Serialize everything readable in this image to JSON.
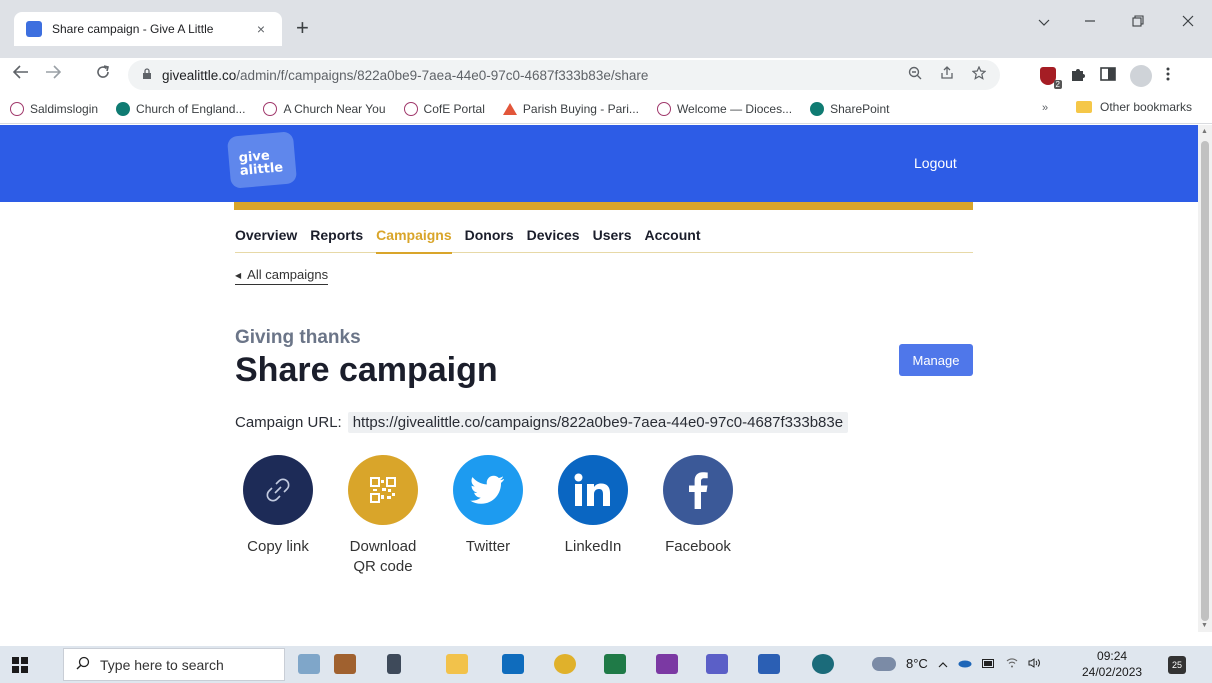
{
  "browser": {
    "tab_title": "Share campaign - Give A Little",
    "tab_close": "×",
    "new_tab": "+",
    "url_host": "givealittle.co",
    "url_path": "/admin/f/campaigns/822a0be9-7aea-44e0-97c0-4687f333b83e/share",
    "extension_badge": "2",
    "bookmarks": [
      {
        "label": "Saldimslogin",
        "icon": "globe-cross-icon"
      },
      {
        "label": "Church of England...",
        "icon": "sharepoint-icon"
      },
      {
        "label": "A Church Near You",
        "icon": "globe-cross-icon"
      },
      {
        "label": "CofE Portal",
        "icon": "globe-cross-icon"
      },
      {
        "label": "Parish Buying - Pari...",
        "icon": "church-icon"
      },
      {
        "label": "Welcome — Dioces...",
        "icon": "globe-cross-icon"
      },
      {
        "label": "SharePoint",
        "icon": "sharepoint-icon"
      }
    ],
    "bookmarks_more": "»",
    "other_bookmarks": "Other bookmarks"
  },
  "site": {
    "logo_text": "give alittle",
    "logout_label": "Logout",
    "nav": [
      "Overview",
      "Reports",
      "Campaigns",
      "Donors",
      "Devices",
      "Users",
      "Account"
    ],
    "active_nav": "Campaigns",
    "back_link": "All campaigns",
    "eyebrow": "Giving thanks",
    "headline": "Share campaign",
    "manage_label": "Manage",
    "url_label": "Campaign URL:",
    "campaign_url": "https://givealittle.co/campaigns/822a0be9-7aea-44e0-97c0-4687f333b83e",
    "share": [
      {
        "label": "Copy link",
        "icon": "link-icon",
        "color": "#1d2b57"
      },
      {
        "label": "Download QR code",
        "icon": "qr-code-icon",
        "color": "#d9a52a"
      },
      {
        "label": "Twitter",
        "icon": "twitter-icon",
        "color": "#1d9bf0"
      },
      {
        "label": "LinkedIn",
        "icon": "linkedin-icon",
        "color": "#0a66c2"
      },
      {
        "label": "Facebook",
        "icon": "facebook-icon",
        "color": "#3b5998"
      }
    ]
  },
  "taskbar": {
    "search_placeholder": "Type here to search",
    "temperature": "8°C",
    "time": "09:24",
    "date": "24/02/2023",
    "notification_count": "25"
  },
  "colors": {
    "brand_blue": "#2d5ce6",
    "accent_gold": "#d9a52a",
    "button_blue": "#4f77ea"
  }
}
